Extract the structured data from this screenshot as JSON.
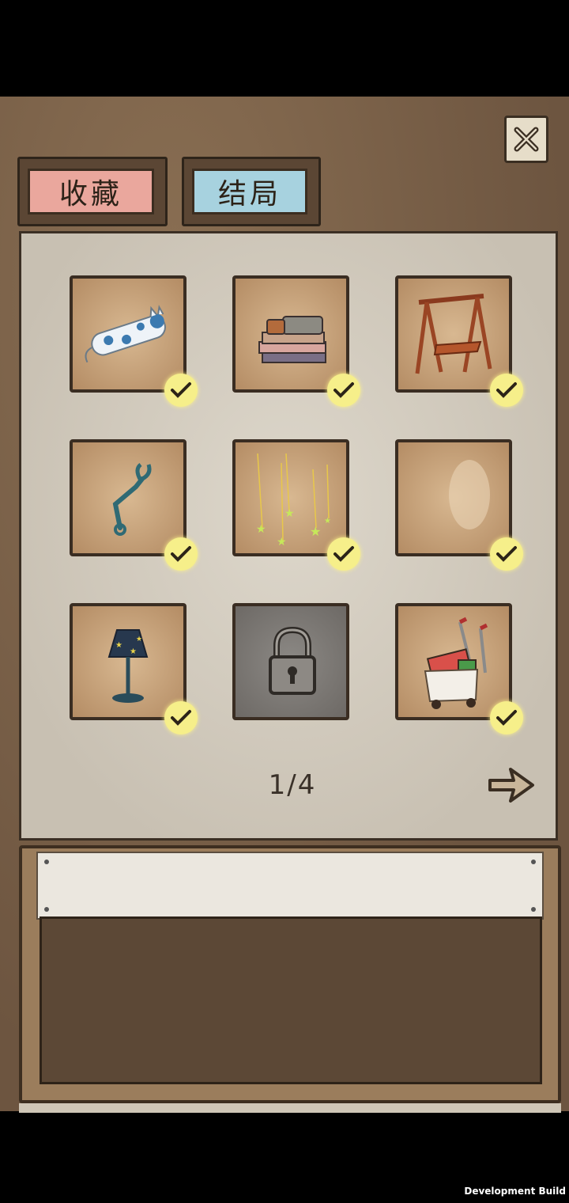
{
  "tabs": [
    {
      "label": "收藏",
      "color": "#eaa79d"
    },
    {
      "label": "结局",
      "color": "#a7d2df"
    }
  ],
  "grid": {
    "items": [
      {
        "icon": "cat-pillow-icon",
        "collected": true,
        "locked": false
      },
      {
        "icon": "book-stack-icon",
        "collected": true,
        "locked": false
      },
      {
        "icon": "wooden-swing-icon",
        "collected": true,
        "locked": false
      },
      {
        "icon": "grabber-claw-icon",
        "collected": true,
        "locked": false
      },
      {
        "icon": "hanging-stars-icon",
        "collected": true,
        "locked": false
      },
      {
        "icon": "blank-item-icon",
        "collected": true,
        "locked": false
      },
      {
        "icon": "star-lamp-icon",
        "collected": true,
        "locked": false
      },
      {
        "icon": "padlock-icon",
        "collected": false,
        "locked": true
      },
      {
        "icon": "shopping-cart-icon",
        "collected": true,
        "locked": false
      }
    ]
  },
  "pager": {
    "text": "1/4"
  },
  "footer": {
    "build_label": "Development Build"
  }
}
